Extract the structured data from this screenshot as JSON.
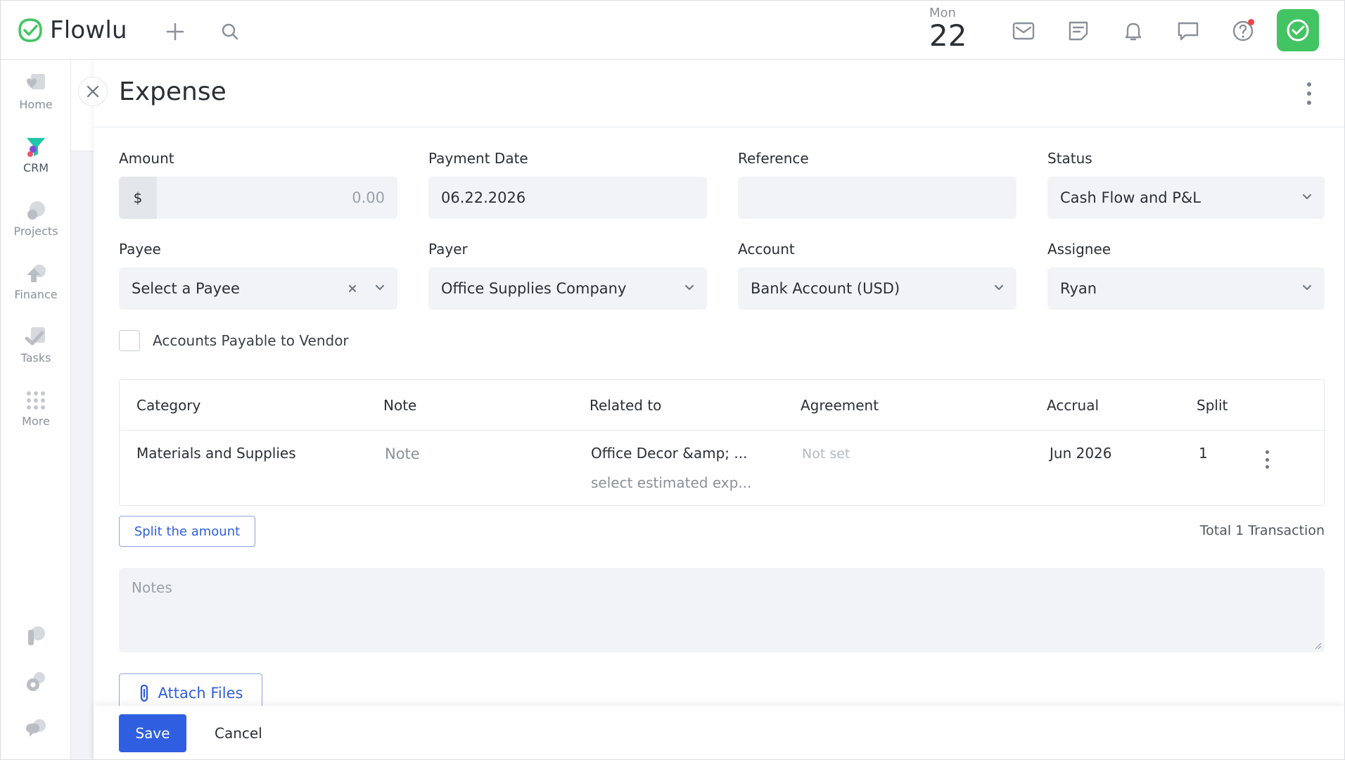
{
  "app": {
    "name": "Flowlu",
    "brand_color": "#43c462",
    "accent_color": "#2f5fe0"
  },
  "header": {
    "day": "Mon",
    "date": "22"
  },
  "sidebar": {
    "items": [
      {
        "label": "Home",
        "icon": "home-icon"
      },
      {
        "label": "CRM",
        "icon": "crm-funnel-icon"
      },
      {
        "label": "Projects",
        "icon": "projects-icon"
      },
      {
        "label": "Finance",
        "icon": "finance-icon"
      },
      {
        "label": "Tasks",
        "icon": "tasks-icon"
      },
      {
        "label": "More",
        "icon": "grid-dots-icon"
      }
    ]
  },
  "panel": {
    "title": "Expense",
    "fields": {
      "amount": {
        "label": "Amount",
        "currency": "$",
        "placeholder": "0.00"
      },
      "payment_date": {
        "label": "Payment Date",
        "value": "06.22.2026"
      },
      "reference": {
        "label": "Reference",
        "value": ""
      },
      "status": {
        "label": "Status",
        "value": "Cash Flow and P&L"
      },
      "payee": {
        "label": "Payee",
        "value": "Select a Payee"
      },
      "payer": {
        "label": "Payer",
        "value": "Office Supplies Company"
      },
      "account": {
        "label": "Account",
        "value": "Bank Account (USD)"
      },
      "assignee": {
        "label": "Assignee",
        "value": "Ryan"
      }
    },
    "accounts_payable": {
      "label": "Accounts Payable to Vendor",
      "checked": false
    },
    "table": {
      "headers": [
        "Category",
        "Note",
        "Related to",
        "Agreement",
        "Accrual",
        "Split"
      ],
      "rows": [
        {
          "category": "Materials and Supplies",
          "note": "Note",
          "related_to": "Office Decor &amp; ...",
          "related_sub": "select estimated exp...",
          "agreement": "Not set",
          "accrual": "Jun 2026",
          "split": "1"
        }
      ]
    },
    "split_button": "Split the amount",
    "total": "Total 1 Transaction",
    "notes_placeholder": "Notes",
    "attach_files": "Attach Files",
    "save": "Save",
    "cancel": "Cancel"
  }
}
